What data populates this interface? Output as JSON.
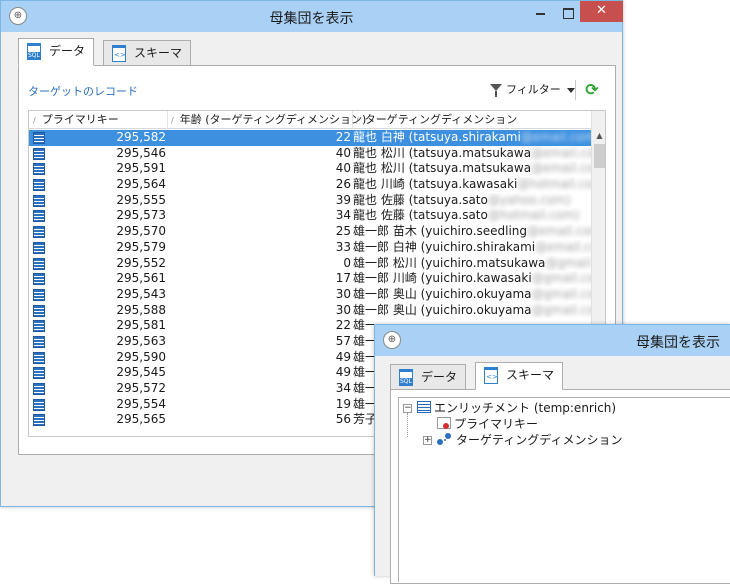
{
  "main_window": {
    "title": "母集団を表示",
    "close_glyph": "✕",
    "tabs": [
      {
        "label": "データ",
        "active": true
      },
      {
        "label": "スキーマ",
        "active": false
      }
    ],
    "section_link": "ターゲットのレコード",
    "filter_label": "フィルター",
    "refresh_glyph": "⟳",
    "columns": [
      "プライマリキー",
      "年齢 (ターゲティングディメンション)",
      "ターゲティングディメンション"
    ],
    "rows": [
      {
        "pk": "295,582",
        "age": "22",
        "td": "龍也 白神 (tatsuya.shirakami",
        "td_redacted": "@email.com",
        "selected": true
      },
      {
        "pk": "295,546",
        "age": "40",
        "td": "龍也 松川 (tatsuya.matsukawa",
        "td_redacted": "@email.com"
      },
      {
        "pk": "295,591",
        "age": "40",
        "td": "龍也 松川 (tatsuya.matsukawa",
        "td_redacted": "@email.com"
      },
      {
        "pk": "295,564",
        "age": "26",
        "td": "龍也 川崎 (tatsuya.kawasaki",
        "td_redacted": "@hotmail.com"
      },
      {
        "pk": "295,555",
        "age": "39",
        "td": "龍也 佐藤 (tatsuya.sato",
        "td_redacted": "@yahoo.com)"
      },
      {
        "pk": "295,573",
        "age": "34",
        "td": "龍也 佐藤 (tatsuya.sato",
        "td_redacted": "@hotmail.com)"
      },
      {
        "pk": "295,570",
        "age": "25",
        "td": "雄一郎 苗木 (yuichiro.seedling",
        "td_redacted": "@email.com"
      },
      {
        "pk": "295,579",
        "age": "33",
        "td": "雄一郎 白神 (yuichiro.shirakami",
        "td_redacted": "@email.com"
      },
      {
        "pk": "295,552",
        "age": "0",
        "td": "雄一郎 松川 (yuichiro.matsukawa",
        "td_redacted": "@gmail.com"
      },
      {
        "pk": "295,561",
        "age": "17",
        "td": "雄一郎 川崎 (yuichiro.kawasaki",
        "td_redacted": "@gmail.com"
      },
      {
        "pk": "295,543",
        "age": "30",
        "td": "雄一郎 奥山 (yuichiro.okuyama",
        "td_redacted": "@gmail.com"
      },
      {
        "pk": "295,588",
        "age": "30",
        "td": "雄一郎 奥山 (yuichiro.okuyama",
        "td_redacted": "@gmail.com"
      },
      {
        "pk": "295,581",
        "age": "22",
        "td": "雄一",
        "td_redacted": ""
      },
      {
        "pk": "295,563",
        "age": "57",
        "td": "雄一",
        "td_redacted": ""
      },
      {
        "pk": "295,590",
        "age": "49",
        "td": "雄一",
        "td_redacted": ""
      },
      {
        "pk": "295,545",
        "age": "49",
        "td": "雄一",
        "td_redacted": ""
      },
      {
        "pk": "295,572",
        "age": "34",
        "td": "雄一",
        "td_redacted": ""
      },
      {
        "pk": "295,554",
        "age": "19",
        "td": "雄一",
        "td_redacted": ""
      },
      {
        "pk": "295,565",
        "age": "56",
        "td": "芳子",
        "td_redacted": ""
      }
    ]
  },
  "second_window": {
    "title": "母集団を表示",
    "tabs": [
      {
        "label": "データ",
        "active": false
      },
      {
        "label": "スキーマ",
        "active": true
      }
    ],
    "tree": {
      "root_label": "エンリッチメント (temp:enrich)",
      "root_expander": "−",
      "child_pk": "プライマリキー",
      "child_td": "ターゲティングディメンション",
      "child_td_expander": "+"
    }
  }
}
